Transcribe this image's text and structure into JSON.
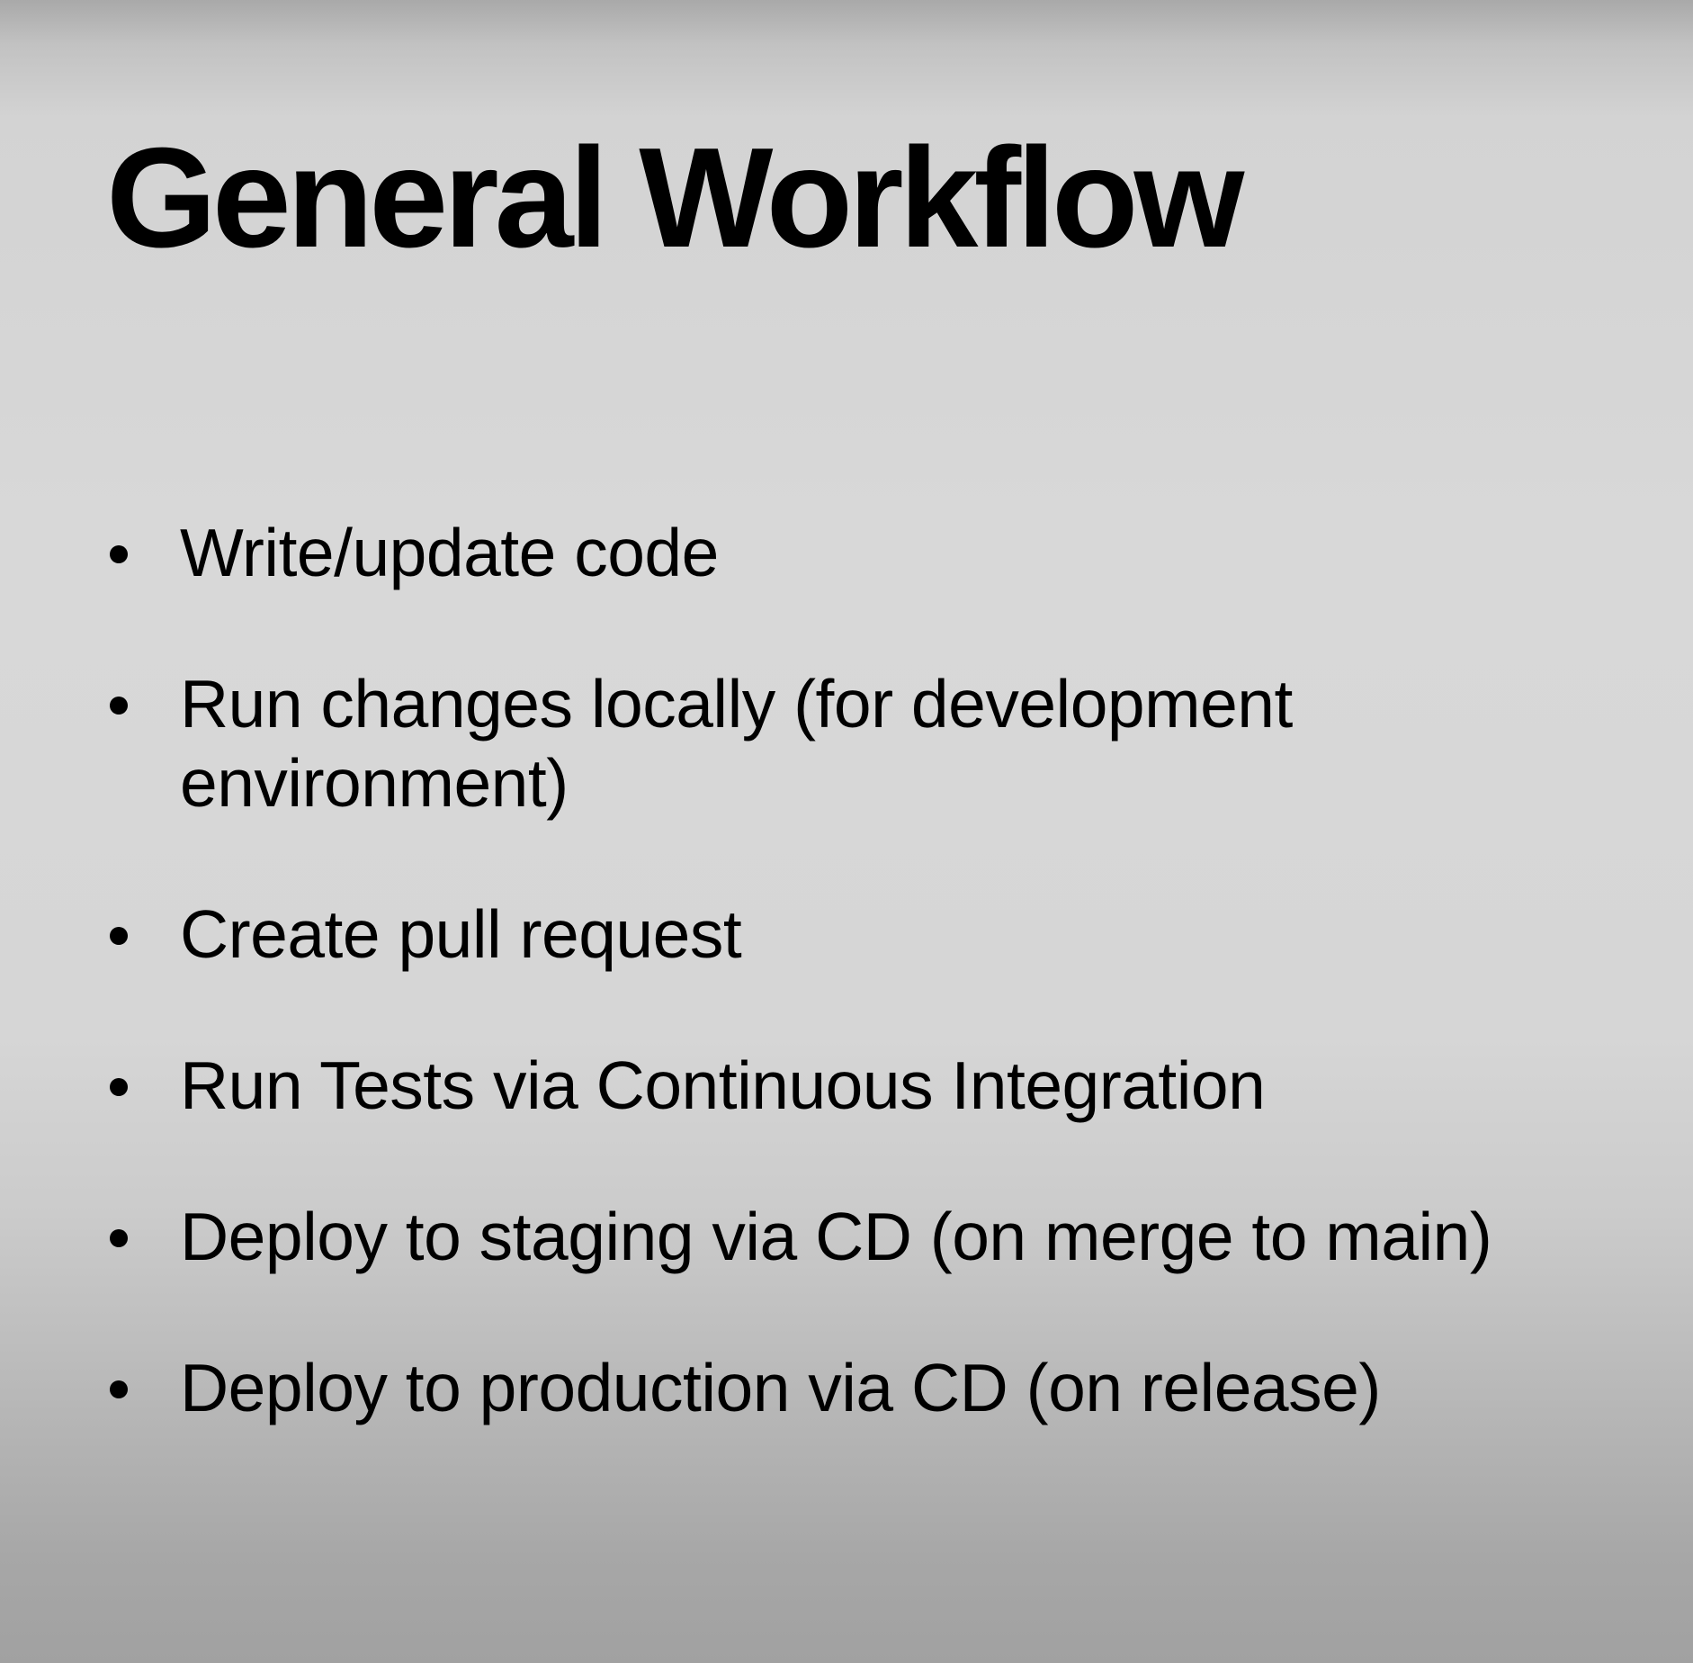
{
  "slide": {
    "title": "General Workflow",
    "bullets": [
      "Write/update code",
      "Run changes locally (for development environment)",
      "Create pull request",
      "Run Tests via Continuous Integration",
      "Deploy to staging via CD (on merge to main)",
      "Deploy to production via CD (on release)"
    ]
  }
}
